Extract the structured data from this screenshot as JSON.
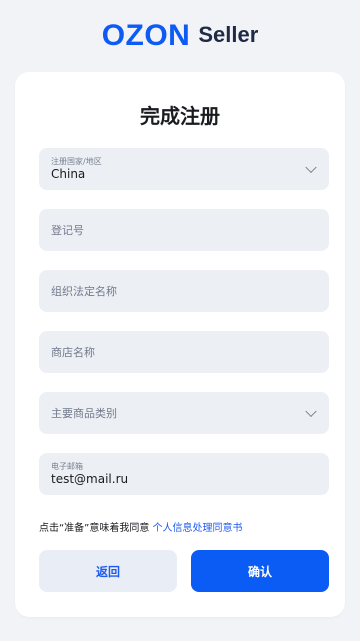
{
  "brand": {
    "logo_text": "OZON",
    "product": "Seller",
    "color": "#0d5bf5"
  },
  "form": {
    "title": "完成注册",
    "country": {
      "label": "注册国家/地区",
      "value": "China"
    },
    "registration_number": {
      "placeholder": "登记号"
    },
    "legal_name": {
      "placeholder": "组织法定名称"
    },
    "store_name": {
      "placeholder": "商店名称"
    },
    "main_category": {
      "placeholder": "主要商品类别"
    },
    "email": {
      "label": "电子邮箱",
      "value": "test@mail.ru"
    },
    "consent": {
      "text": "点击“准备”意味着我同意",
      "link": "个人信息处理同意书"
    },
    "back_label": "返回",
    "confirm_label": "确认"
  },
  "colors": {
    "accent": "#0a5cf5",
    "field_bg": "#eceff4",
    "page_bg": "#f1f3f6"
  }
}
